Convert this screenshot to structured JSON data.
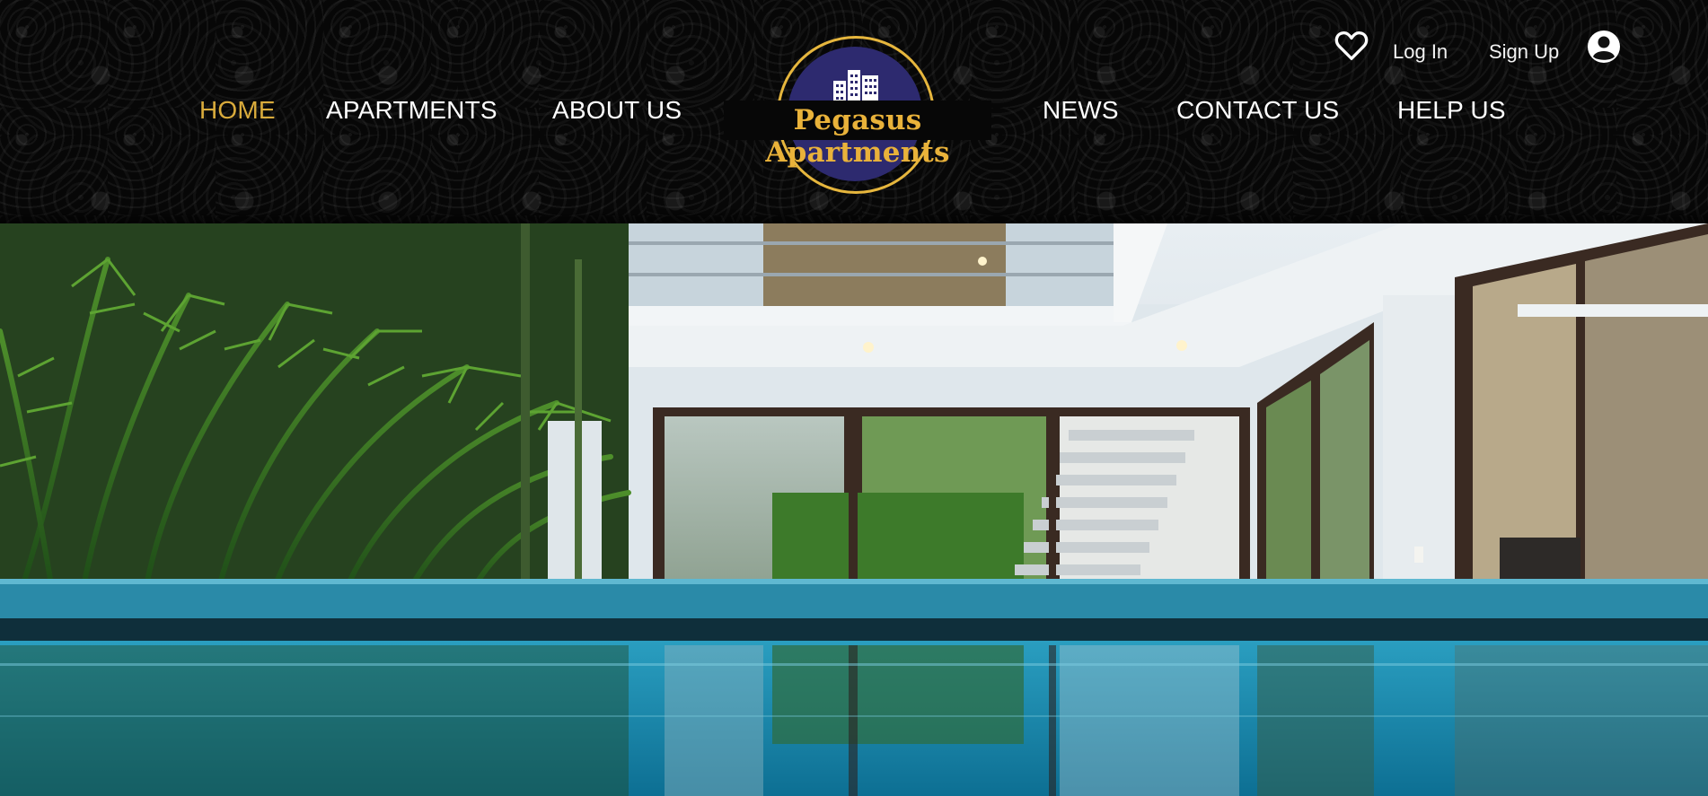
{
  "nav": {
    "left": [
      {
        "label": "HOME",
        "active": true
      },
      {
        "label": "APARTMENTS",
        "active": false
      },
      {
        "label": "ABOUT US",
        "active": false
      }
    ],
    "right": [
      {
        "label": "NEWS",
        "active": false
      },
      {
        "label": "CONTACT US",
        "active": false
      },
      {
        "label": "HELP US",
        "active": false
      }
    ]
  },
  "brand": {
    "name": "Pegasus Apartments",
    "logo_icon": "building-icon"
  },
  "account": {
    "favorites_icon": "heart-icon",
    "login_label": "Log In",
    "signup_label": "Sign Up",
    "profile_icon": "user-icon"
  },
  "hero": {
    "image": "modern-house-courtyard-pool-photo"
  },
  "colors": {
    "header_bg": "#070707",
    "nav_text": "#ffffff",
    "nav_active": "#d9ab3c",
    "logo_gold": "#e9b23a",
    "logo_navy": "#2d2a6f",
    "pool": "#1e8fb0"
  }
}
